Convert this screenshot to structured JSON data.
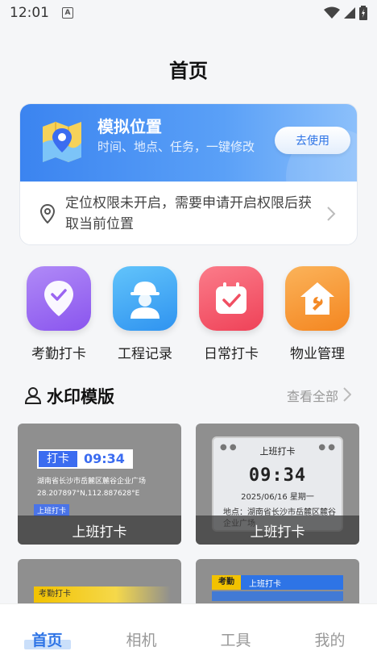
{
  "status_bar": {
    "time": "12:01",
    "notification_glyph": "A"
  },
  "page": {
    "title": "首页"
  },
  "mock_location": {
    "title": "模拟位置",
    "subtitle": "时间、地点、任务，一键修改",
    "button_label": "去使用",
    "permission_text": "定位权限未开启，需要申请开启权限后获取当前位置"
  },
  "quick_actions": [
    {
      "label": "考勤打卡",
      "icon": "location-check-icon",
      "color": "#9d6cf2"
    },
    {
      "label": "工程记录",
      "icon": "worker-helmet-icon",
      "color": "#3aa6f5"
    },
    {
      "label": "日常打卡",
      "icon": "calendar-check-icon",
      "color": "#f4586a"
    },
    {
      "label": "物业管理",
      "icon": "house-wrench-icon",
      "color": "#f7932a"
    }
  ],
  "watermark_section": {
    "title": "水印模版",
    "see_all": "查看全部"
  },
  "templates": [
    {
      "caption": "上班打卡",
      "tag": "打卡",
      "time": "09:34",
      "address": "湖南省长沙市岳麓区麓谷企业广场",
      "coords": "28.207897°N,112.887628°E",
      "small_tag": "上班打卡"
    },
    {
      "caption": "上班打卡",
      "head": "上班打卡",
      "time": "09:34",
      "date": "2025/06/16  星期一",
      "location": "地点：湖南省长沙市岳麓区麓谷企业广场"
    },
    {
      "band": "考勤打卡"
    },
    {
      "band_tag": "考勤",
      "band_text": "上班打卡"
    }
  ],
  "bottom_nav": [
    {
      "label": "首页",
      "active": true
    },
    {
      "label": "相机",
      "active": false
    },
    {
      "label": "工具",
      "active": false
    },
    {
      "label": "我的",
      "active": false
    }
  ],
  "colors": {
    "accent": "#2e74e6",
    "banner_start": "#3b84f0",
    "banner_end": "#8cc0fb"
  }
}
